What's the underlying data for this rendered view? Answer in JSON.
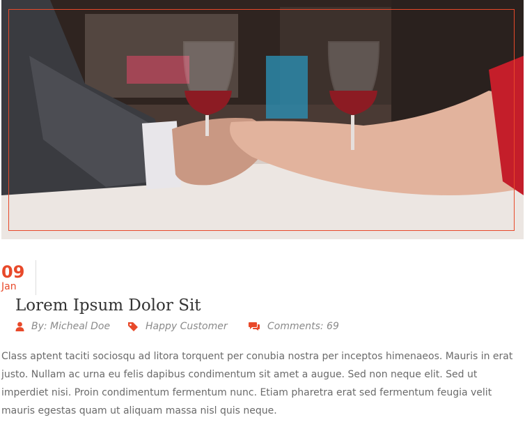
{
  "post": {
    "image_alt": "Couple holding hands across a table with glasses of red wine",
    "date": {
      "day": "09",
      "month": "Jan"
    },
    "title": "Lorem Ipsum Dolor Sit",
    "meta": {
      "author": "By: Micheal Doe",
      "category": "Happy Customer",
      "comments": "Comments: 69"
    },
    "excerpt": "Class aptent taciti sociosqu ad litora torquent per conubia nostra per inceptos himenaeos. Mauris in erat justo. Nullam ac urna eu felis dapibus condimentum sit amet a augue. Sed non neque elit. Sed ut imperdiet nisi. Proin condimentum fermentum nunc. Etiam pharetra erat sed fermentum feugia velit mauris egestas quam ut aliquam massa nisl quis neque."
  },
  "colors": {
    "accent": "#e8492a",
    "title": "#333333",
    "meta": "#8a8a8a",
    "text": "#6a6a6a"
  },
  "icons": {
    "author": "user-icon",
    "category": "tag-icon",
    "comments": "comments-icon"
  }
}
